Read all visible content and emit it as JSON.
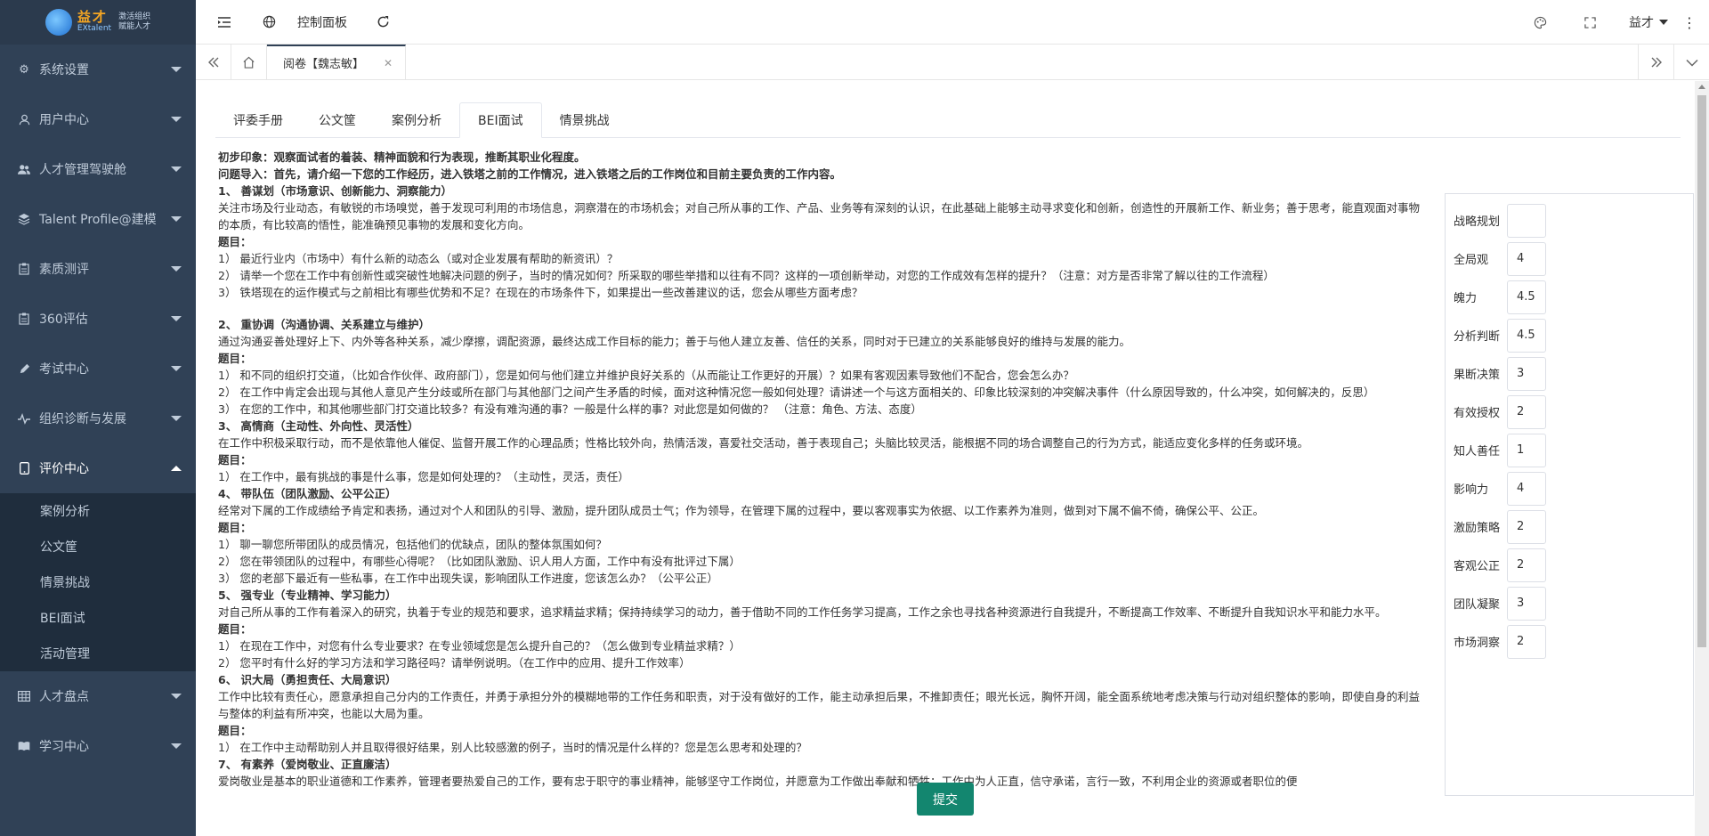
{
  "logo": {
    "main": "益才",
    "sub": "EXtalent",
    "tag1": "激活组织",
    "tag2": "赋能人才"
  },
  "sidebar": {
    "items": [
      {
        "label": "系统设置",
        "icon": "gear-icon"
      },
      {
        "label": "用户中心",
        "icon": "user-icon"
      },
      {
        "label": "人才管理驾驶舱",
        "icon": "users-icon"
      },
      {
        "label": "Talent Profile@建模",
        "icon": "layers-icon"
      },
      {
        "label": "素质测评",
        "icon": "clipboard-icon"
      },
      {
        "label": "360评估",
        "icon": "clipboard-icon"
      },
      {
        "label": "考试中心",
        "icon": "pen-icon"
      },
      {
        "label": "组织诊断与发展",
        "icon": "pulse-icon"
      },
      {
        "label": "评价中心",
        "icon": "tablet-icon"
      }
    ],
    "submenu": [
      "案例分析",
      "公文筐",
      "情景挑战",
      "BEI面试",
      "活动管理"
    ],
    "items_after": [
      {
        "label": "人才盘点",
        "icon": "grid-icon"
      },
      {
        "label": "学习中心",
        "icon": "book-icon"
      }
    ]
  },
  "navbar": {
    "title": "控制面板",
    "user": "益才"
  },
  "tagsbar": {
    "active_tag": "阅卷【魏志敏】"
  },
  "tabs": [
    "评委手册",
    "公文筐",
    "案例分析",
    "BEI面试",
    "情景挑战"
  ],
  "content": {
    "lines": [
      {
        "t": "初步印象：观察面试者的着装、精神面貌和行为表现，推断其职业化程度。",
        "b": true
      },
      {
        "t": "问题导入：首先，请介绍一下您的工作经历，进入铁塔之前的工作情况，进入铁塔之后的工作岗位和目前主要负责的工作内容。",
        "b": true
      },
      {
        "t": "1、 善谋划（市场意识、创新能力、洞察能力）",
        "b": true
      },
      {
        "t": "关注市场及行业动态，有敏锐的市场嗅觉，善于发现可利用的市场信息，洞察潜在的市场机会；对自己所从事的工作、产品、业务等有深刻的认识，在此基础上能够主动寻求变化和创新，创造性的开展新工作、新业务；善于思考，能直观面对事物的本质，有比较高的悟性，能准确预见事物的发展和变化方向。",
        "b": false
      },
      {
        "t": "题目：",
        "b": true
      },
      {
        "t": "1）  最近行业内（市场中）有什么新的动态么（或对企业发展有帮助的新资讯）？",
        "b": false
      },
      {
        "t": "2）  请举一个您在工作中有创新性或突破性地解决问题的例子，当时的情况如何？所采取的哪些举措和以往有不同？这样的一项创新举动，对您的工作成效有怎样的提升？（注意：对方是否非常了解以往的工作流程）",
        "b": false
      },
      {
        "t": "3）  铁塔现在的运作模式与之前相比有哪些优势和不足？在现在的市场条件下，如果提出一些改善建议的话，您会从哪些方面考虑？",
        "b": false
      },
      {
        "t": "",
        "b": false
      },
      {
        "t": "2、 重协调（沟通协调、关系建立与维护）",
        "b": true
      },
      {
        "t": "通过沟通妥善处理好上下、内外等各种关系，减少摩擦，调配资源，最终达成工作目标的能力；善于与他人建立友善、信任的关系，同时对于已建立的关系能够良好的维持与发展的能力。",
        "b": false
      },
      {
        "t": "题目：",
        "b": true
      },
      {
        "t": "1）  和不同的组织打交道，（比如合作伙伴、政府部门），您是如何与他们建立并维护良好关系的（从而能让工作更好的开展）？如果有客观因素导致他们不配合，您会怎么办？",
        "b": false
      },
      {
        "t": "2）  在工作中肯定会出现与其他人意见产生分歧或所在部门与其他部门之间产生矛盾的时候，面对这种情况您一般如何处理？请讲述一个与这方面相关的、印象比较深刻的冲突解决事件（什么原因导致的，什么冲突，如何解决的，反思）",
        "b": false
      },
      {
        "t": "3）  在您的工作中，和其他哪些部门打交道比较多？有没有难沟通的事？一般是什么样的事？对此您是如何做的？ （注意：角色、方法、态度）",
        "b": false
      },
      {
        "t": "3、 高情商（主动性、外向性、灵活性）",
        "b": true
      },
      {
        "t": "在工作中积极采取行动，而不是依靠他人催促、监督开展工作的心理品质；性格比较外向，热情活泼，喜爱社交活动，善于表现自己；头脑比较灵活，能根据不同的场合调整自己的行为方式，能适应变化多样的任务或环境。",
        "b": false
      },
      {
        "t": "题目：",
        "b": true
      },
      {
        "t": "1）  在工作中，最有挑战的事是什么事，您是如何处理的？（主动性，灵活，责任）",
        "b": false
      },
      {
        "t": "4、 带队伍（团队激励、公平公正）",
        "b": true
      },
      {
        "t": "经常对下属的工作成绩给予肯定和表扬，通过对个人和团队的引导、激励，提升团队成员士气；作为领导，在管理下属的过程中，要以客观事实为依据、以工作素养为准则，做到对下属不偏不倚，确保公平、公正。",
        "b": false
      },
      {
        "t": "题目：",
        "b": true
      },
      {
        "t": "1）  聊一聊您所带团队的成员情况，包括他们的优缺点，团队的整体氛围如何？",
        "b": false
      },
      {
        "t": "2）  您在带领团队的过程中，有哪些心得呢？（比如团队激励、识人用人方面，工作中有没有批评过下属）",
        "b": false
      },
      {
        "t": "3）  您的老部下最近有一些私事，在工作中出现失误，影响团队工作进度，您该怎么办？（公平公正）",
        "b": false
      },
      {
        "t": "5、 强专业（专业精神、学习能力）",
        "b": true
      },
      {
        "t": "对自己所从事的工作有着深入的研究，执着于专业的规范和要求，追求精益求精；保持持续学习的动力，善于借助不同的工作任务学习提高，工作之余也寻找各种资源进行自我提升，不断提高工作效率、不断提升自我知识水平和能力水平。",
        "b": false
      },
      {
        "t": "题目：",
        "b": true
      },
      {
        "t": "1）  在现在工作中，对您有什么专业要求？在专业领域您是怎么提升自己的？（怎么做到专业精益求精？）",
        "b": false
      },
      {
        "t": "2）  您平时有什么好的学习方法和学习路径吗？请举例说明。（在工作中的应用、提升工作效率）",
        "b": false
      },
      {
        "t": "6、 识大局（勇担责任、大局意识）",
        "b": true
      },
      {
        "t": "工作中比较有责任心，愿意承担自己分内的工作责任，并勇于承担分外的模糊地带的工作任务和职责，对于没有做好的工作，能主动承担后果，不推卸责任；眼光长远，胸怀开阔，能全面系统地考虑决策与行动对组织整体的影响，即使自身的利益与整体的利益有所冲突，也能以大局为重。",
        "b": false
      },
      {
        "t": "题目：",
        "b": true
      },
      {
        "t": "1）  在工作中主动帮助别人并且取得很好结果，别人比较感激的例子，当时的情况是什么样的？您是怎么思考和处理的？",
        "b": false
      },
      {
        "t": "7、 有素养（爱岗敬业、正直廉洁）",
        "b": true
      },
      {
        "t": "爱岗敬业是基本的职业道德和工作素养，管理者要热爱自己的工作，要有忠于职守的事业精神，能够坚守工作岗位，并愿意为工作做出奉献和牺牲；工作中为人正直，信守承诺，言行一致，不利用企业的资源或者职位的便",
        "b": false
      }
    ]
  },
  "scores": [
    {
      "label": "战略规划",
      "value": ""
    },
    {
      "label": "全局观",
      "value": "4"
    },
    {
      "label": "魄力",
      "value": "4.5"
    },
    {
      "label": "分析判断",
      "value": "4.5"
    },
    {
      "label": "果断决策",
      "value": "3"
    },
    {
      "label": "有效授权",
      "value": "2"
    },
    {
      "label": "知人善任",
      "value": "1"
    },
    {
      "label": "影响力",
      "value": "4"
    },
    {
      "label": "激励策略",
      "value": "2"
    },
    {
      "label": "客观公正",
      "value": "2"
    },
    {
      "label": "团队凝聚",
      "value": "3"
    },
    {
      "label": "市场洞察",
      "value": "2"
    }
  ],
  "submit_label": "提交"
}
